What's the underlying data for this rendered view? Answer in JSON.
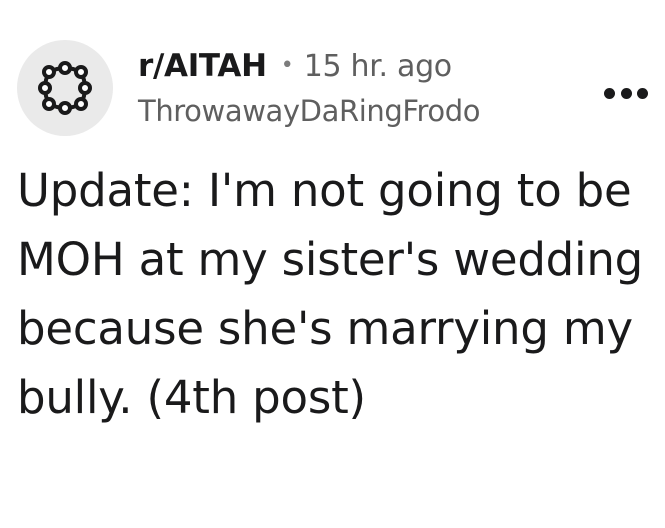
{
  "post": {
    "subreddit": "r/AITAH",
    "separator": "•",
    "time_ago": "15 hr. ago",
    "username": "ThrowawayDaRingFrodo",
    "title": "Update: I'm not going to be MOH at my sister's wedding because she's marrying my bully. (4th post)"
  },
  "icons": {
    "avatar": "subreddit-ring-icon",
    "more": "more-options-icon"
  },
  "colors": {
    "background": "#ffffff",
    "text_primary": "#1a1a1b",
    "text_secondary": "#5f5f5f",
    "avatar_bg": "#eaeaea"
  }
}
